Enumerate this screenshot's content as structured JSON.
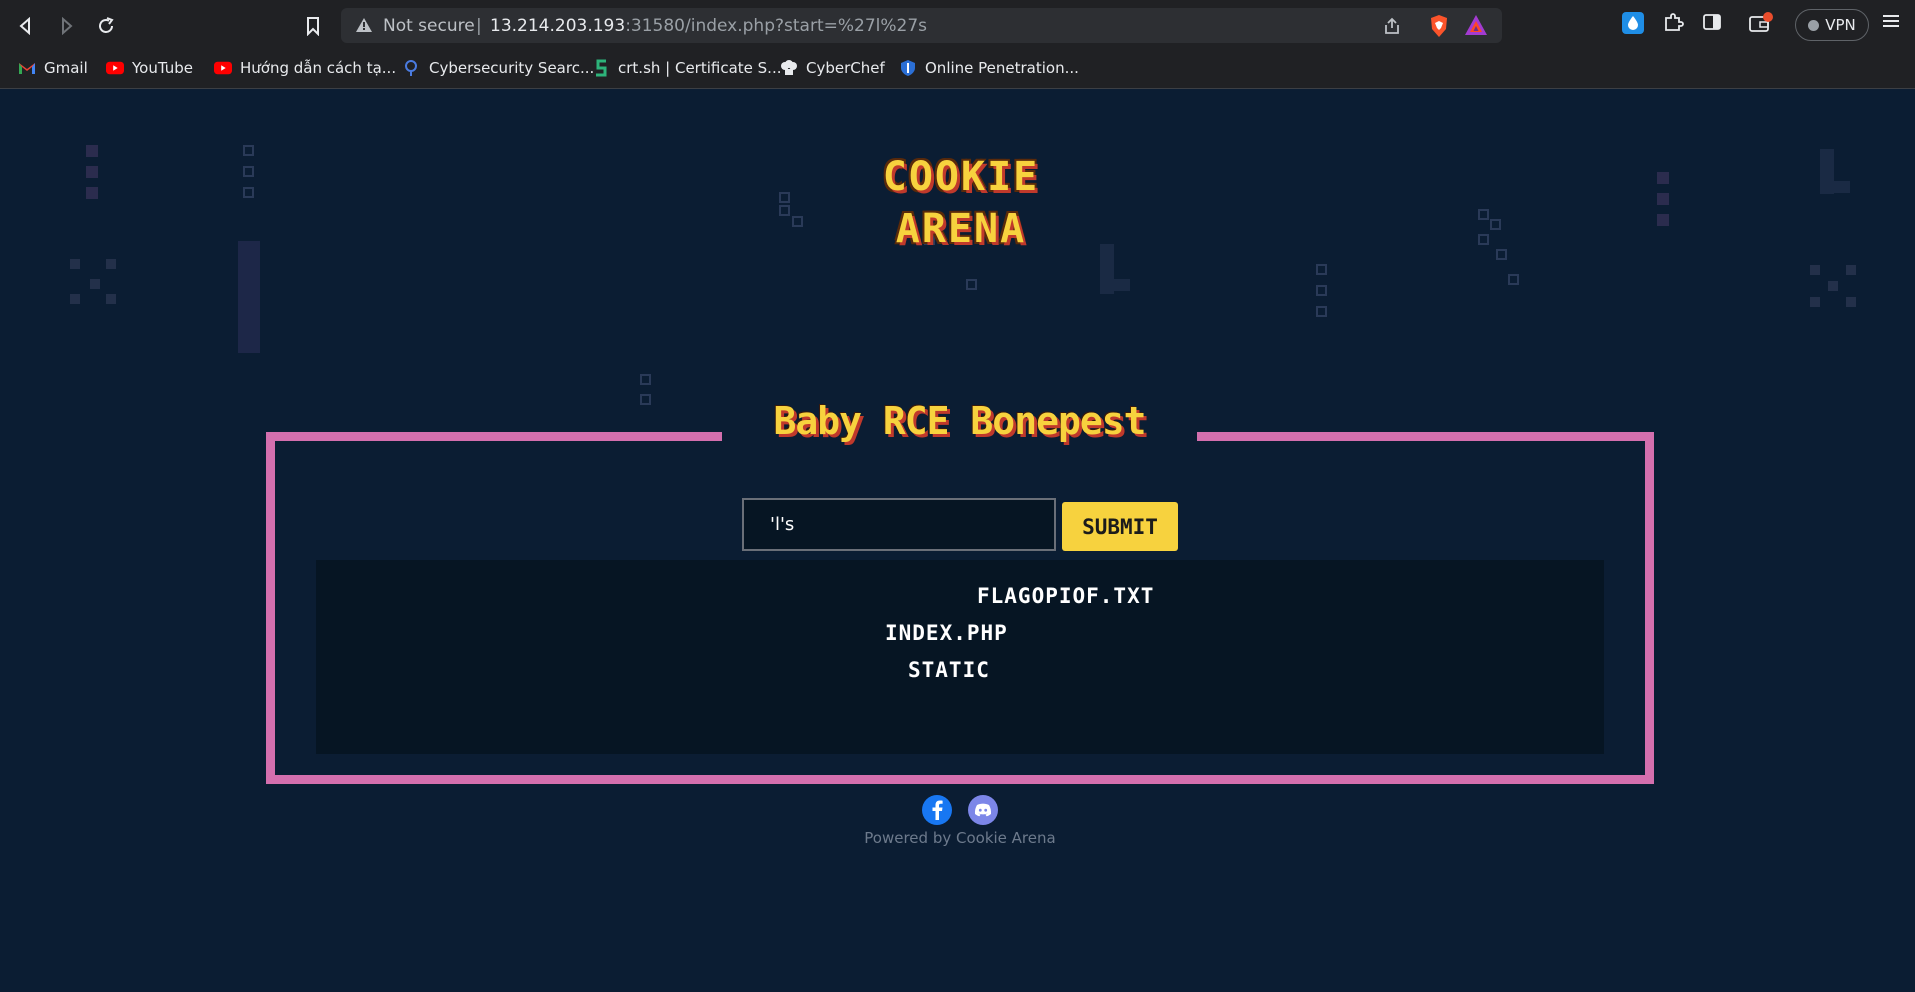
{
  "browser": {
    "security_label": "Not secure",
    "separator": "|",
    "url_host": "13.214.203.193",
    "url_rest": ":31580/index.php?start=%27l%27s",
    "vpn_label": "VPN",
    "icons": [
      "back-icon",
      "forward-icon",
      "reload-icon",
      "bookmark-icon",
      "warning-icon",
      "share-icon",
      "brave-shield-icon",
      "bat-rewards-icon",
      "extension-drop-icon",
      "extensions-puzzle-icon",
      "sidebar-icon",
      "wallet-icon",
      "menu-icon"
    ]
  },
  "bookmarks": [
    {
      "label": "Gmail",
      "icon": "gmail-icon"
    },
    {
      "label": "YouTube",
      "icon": "youtube-icon"
    },
    {
      "label": "Hướng dẫn cách tạ...",
      "icon": "youtube-icon"
    },
    {
      "label": "Cybersecurity Searc...",
      "icon": "search-icon"
    },
    {
      "label": "crt.sh | Certificate S...",
      "icon": "crtsh-icon"
    },
    {
      "label": "CyberChef",
      "icon": "chef-icon"
    },
    {
      "label": "Online Penetration...",
      "icon": "shield-icon"
    }
  ],
  "page": {
    "logo_line1": "COOKIE",
    "logo_line2": "ARENA",
    "title": "Baby RCE Bonepest",
    "input_value": "'l's",
    "submit_label": "SUBMIT",
    "output_lines": [
      "FLAGOPIOF.TXT",
      "INDEX.PHP",
      "STATIC"
    ],
    "footer": "Powered by Cookie Arena"
  },
  "colors": {
    "background": "#0b1d33",
    "frame": "#d46fae",
    "accent_yellow": "#f7d23e",
    "output_bg": "#061523"
  }
}
